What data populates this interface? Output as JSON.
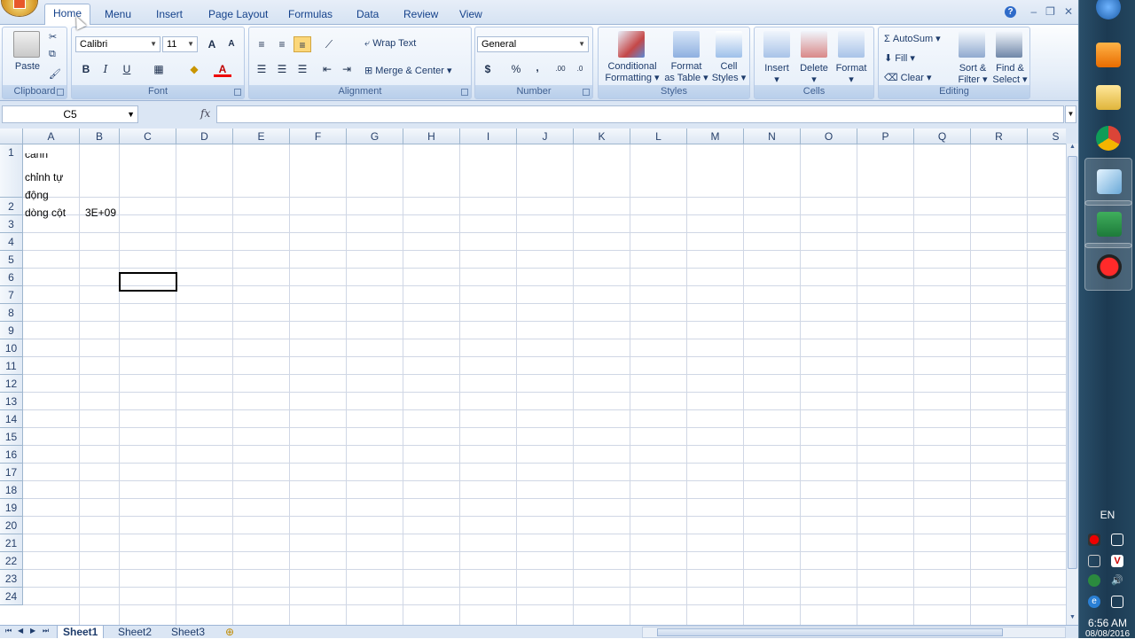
{
  "tabs": [
    {
      "label": "Home",
      "active": true
    },
    {
      "label": "Menu"
    },
    {
      "label": "Insert"
    },
    {
      "label": "Page Layout"
    },
    {
      "label": "Formulas"
    },
    {
      "label": "Data"
    },
    {
      "label": "Review"
    },
    {
      "label": "View"
    }
  ],
  "ribbon": {
    "clipboard": {
      "label": "Clipboard",
      "paste": "Paste"
    },
    "font": {
      "label": "Font",
      "name": "Calibri",
      "size": "11",
      "bold": "B",
      "italic": "I",
      "underline": "U",
      "grow": "A",
      "shrink": "A",
      "color_letter": "A"
    },
    "alignment": {
      "label": "Alignment",
      "wrap_text": "Wrap Text",
      "merge_center": "Merge & Center"
    },
    "number": {
      "label": "Number",
      "format": "General",
      "currency": "$",
      "percent": "%",
      "comma": ",",
      "inc_dec": ".00",
      "dec_dec": ".0"
    },
    "styles": {
      "label": "Styles",
      "conditional_1": "Conditional",
      "conditional_2": "Formatting",
      "format_table_1": "Format",
      "format_table_2": "as Table",
      "cell_styles_1": "Cell",
      "cell_styles_2": "Styles"
    },
    "cells": {
      "label": "Cells",
      "insert": "Insert",
      "delete": "Delete",
      "format": "Format"
    },
    "editing": {
      "label": "Editing",
      "autosum": "AutoSum",
      "fill": "Fill",
      "clear": "Clear",
      "sort_1": "Sort &",
      "sort_2": "Filter",
      "find_1": "Find &",
      "find_2": "Select"
    }
  },
  "formula_bar": {
    "name_box": "C5",
    "fx": "fx",
    "value": ""
  },
  "columns": [
    "A",
    "B",
    "C",
    "D",
    "E",
    "F",
    "G",
    "H",
    "I",
    "J",
    "K",
    "L",
    "M",
    "N",
    "O",
    "P",
    "Q",
    "R",
    "S"
  ],
  "rows": [
    "1",
    "2",
    "3",
    "4",
    "5",
    "6",
    "7",
    "8",
    "9",
    "10",
    "11",
    "12",
    "13",
    "14",
    "15",
    "16",
    "17",
    "18",
    "19",
    "20",
    "21",
    "22",
    "23",
    "24"
  ],
  "cells": {
    "A1_line0": "canh",
    "A1_line1": "chỉnh tự",
    "A1_line2": "động",
    "A2": "dòng cột",
    "B2": "3E+09"
  },
  "sheets": [
    {
      "label": "Sheet1",
      "active": true
    },
    {
      "label": "Sheet2"
    },
    {
      "label": "Sheet3"
    }
  ],
  "taskbar": {
    "language": "EN",
    "time": "6:56 AM",
    "date": "08/08/2016"
  },
  "colors": {
    "ribbon_bg": "#dbe6f4",
    "accent": "#15428b",
    "grid_line": "#d0d7e5"
  }
}
